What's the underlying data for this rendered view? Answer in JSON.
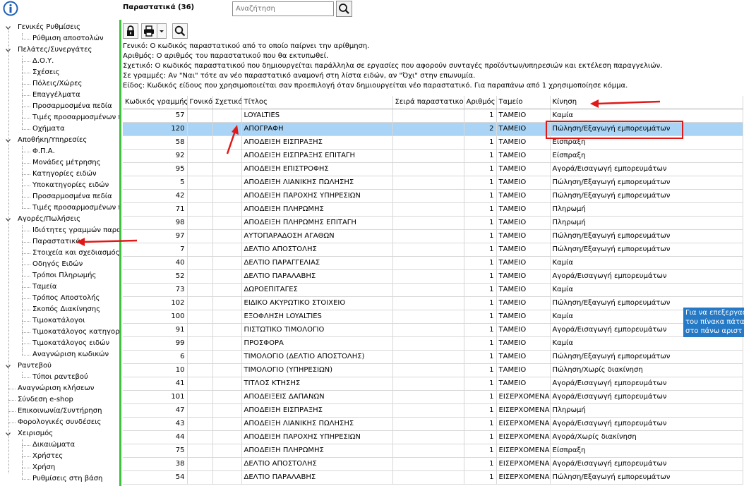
{
  "app": {
    "title": "Παραστατικά (36)"
  },
  "search": {
    "placeholder": "Αναζήτηση"
  },
  "toolbar": {
    "buttons": [
      "lock-icon",
      "printer-icon",
      "dropdown-arrow-icon",
      "search-icon"
    ]
  },
  "sidebar": {
    "groups": [
      {
        "label": "Γενικές Ρυθμίσεις",
        "items": [
          "Ρύθμιση αποστολών"
        ]
      },
      {
        "label": "Πελάτες/Συνεργάτες",
        "items": [
          "Δ.Ο.Υ.",
          "Σχέσεις",
          "Πόλεις/Χώρες",
          "Επαγγέλματα",
          "Προσαρμοσμένα πεδία",
          "Τιμές προσαρμοσμένων π",
          "Οχήματα"
        ]
      },
      {
        "label": "Αποθήκη/Υπηρεσίες",
        "items": [
          "Φ.Π.Α.",
          "Μονάδες μέτρησης",
          "Κατηγορίες ειδών",
          "Υποκατηγορίες ειδών",
          "Προσαρμοσμένα πεδία",
          "Τιμές προσαρμοσμένων π"
        ]
      },
      {
        "label": "Αγορές/Πωλήσεις",
        "items": [
          "Ιδιότητες γραμμών παρασ",
          "Παραστατικά",
          "Στοιχεία και σχεδιασμός π",
          "Οδηγός Ειδών",
          "Τρόποι Πληρωμής",
          "Ταμεία",
          "Τρόπος Αποστολής",
          "Σκοπός Διακίνησης",
          "Τιμοκατάλογοι",
          "Τιμοκατάλογος κατηγοριώ",
          "Τιμοκατάλογος ειδών",
          "Αναγνώριση κωδικών"
        ]
      },
      {
        "label": "Ραντεβού",
        "items": [
          "Τύποι ραντεβού"
        ]
      },
      {
        "label": "Αναγνώριση κλήσεων",
        "items": []
      },
      {
        "label": "Σύνδεση e-shop",
        "items": []
      },
      {
        "label": "Επικοινωνία/Συντήρηση",
        "items": []
      },
      {
        "label": "Φορολογικές συνδέσεις",
        "items": []
      },
      {
        "label": "Χειρισμός",
        "items": [
          "Δικαιώματα",
          "Χρήστες",
          "Χρήση",
          "Ρυθμίσεις στη βάση"
        ]
      }
    ]
  },
  "description": [
    "Γενικό: Ο κωδικός παραστατικού από το οποίο παίρνει την αρίθμηση.",
    "Αριθμός: Ο αριθμός του παραστατικού που θα εκτυπωθεί.",
    "Σχετικό: Ο κωδικός παραστατικού που δημιουργείται παράλληλα σε εργασίες που αφορούν συνταγές προϊόντων/υπηρεσιών και εκτέλεση παραγγελιών.",
    "Σε γραμμές: Αν \"Ναι\" τότε αν νέο παραστατικό αναμονή στη λίστα ειδών, αν \"Όχι\" στην επωνυμία.",
    "Είδος: Κωδικός είδους που χρησιμοποιείται σαν προεπιλογή όταν δημιουργείται νέο παραστατικό. Για παραπάνω από 1 χρησιμοποίησε κόμμα."
  ],
  "table": {
    "columns": [
      "Κωδικός γραμμής",
      "Γονικό",
      "Σχετικό",
      "Τίτλος",
      "Σειρά παραστατικού",
      "Αριθμός",
      "Ταμείο",
      "Κίνηση"
    ],
    "rows": [
      [
        "57",
        "",
        "",
        "LOYALTIES",
        "",
        "1",
        "ΤΑΜΕΙΟ",
        "Καμία"
      ],
      [
        "120",
        "",
        "",
        "ΑΠΟΓΡΑΦΗ",
        "",
        "2",
        "ΤΑΜΕΙΟ",
        "Πώληση/Εξαγωγή εμπορευμάτων"
      ],
      [
        "58",
        "",
        "",
        "ΑΠΟΔΕΙΞΗ ΕΙΣΠΡΑΞΗΣ",
        "",
        "1",
        "ΤΑΜΕΙΟ",
        "Είσπραξη"
      ],
      [
        "92",
        "",
        "",
        "ΑΠΟΔΕΙΞΗ ΕΙΣΠΡΑΞΗΣ ΕΠΙΤΑΓΗ",
        "",
        "1",
        "ΤΑΜΕΙΟ",
        "Είσπραξη"
      ],
      [
        "95",
        "",
        "",
        "ΑΠΟΔΕΙΞΗ ΕΠΙΣΤΡΟΦΗΣ",
        "",
        "1",
        "ΤΑΜΕΙΟ",
        "Αγορά/Εισαγωγή εμπορευμάτων"
      ],
      [
        "5",
        "",
        "",
        "ΑΠΟΔΕΙΞΗ ΛΙΑΝΙΚΗΣ ΠΩΛΗΣΗΣ",
        "",
        "1",
        "ΤΑΜΕΙΟ",
        "Πώληση/Εξαγωγή εμπορευμάτων"
      ],
      [
        "42",
        "",
        "",
        "ΑΠΟΔΕΙΞΗ ΠΑΡΟΧΗΣ ΥΠΗΡΕΣΙΩΝ",
        "",
        "1",
        "ΤΑΜΕΙΟ",
        "Πώληση/Εξαγωγή εμπορευμάτων"
      ],
      [
        "71",
        "",
        "",
        "ΑΠΟΔΕΙΞΗ ΠΛΗΡΩΜΗΣ",
        "",
        "1",
        "ΤΑΜΕΙΟ",
        "Πληρωμή"
      ],
      [
        "98",
        "",
        "",
        "ΑΠΟΔΕΙΞΗ ΠΛΗΡΩΜΗΣ ΕΠΙΤΑΓΗ",
        "",
        "1",
        "ΤΑΜΕΙΟ",
        "Πληρωμή"
      ],
      [
        "97",
        "",
        "",
        "ΑΥΤΟΠΑΡΑΔΟΣΗ ΑΓΑΘΩΝ",
        "",
        "1",
        "ΤΑΜΕΙΟ",
        "Πώληση/Εξαγωγή εμπορευμάτων"
      ],
      [
        "7",
        "",
        "",
        "ΔΕΛΤΙΟ ΑΠΟΣΤΟΛΗΣ",
        "",
        "1",
        "ΤΑΜΕΙΟ",
        "Πώληση/Εξαγωγή εμπορευμάτων"
      ],
      [
        "40",
        "",
        "",
        "ΔΕΛΤΙΟ ΠΑΡΑΓΓΕΛΙΑΣ",
        "",
        "1",
        "ΤΑΜΕΙΟ",
        "Καμία"
      ],
      [
        "52",
        "",
        "",
        "ΔΕΛΤΙΟ ΠΑΡΑΛΑΒΗΣ",
        "",
        "1",
        "ΤΑΜΕΙΟ",
        "Αγορά/Εισαγωγή εμπορευμάτων"
      ],
      [
        "73",
        "",
        "",
        "ΔΩΡΟΕΠΙΤΑΓΕΣ",
        "",
        "1",
        "ΤΑΜΕΙΟ",
        "Καμία"
      ],
      [
        "102",
        "",
        "",
        "ΕΙΔΙΚΟ ΑΚΥΡΩΤΙΚΟ ΣΤΟΙΧΕΙΟ",
        "",
        "1",
        "ΤΑΜΕΙΟ",
        "Πώληση/Εξαγωγή εμπορευμάτων"
      ],
      [
        "100",
        "",
        "",
        "ΕΞΟΦΛΗΣΗ LOYALTIES",
        "",
        "1",
        "ΤΑΜΕΙΟ",
        "Καμία"
      ],
      [
        "91",
        "",
        "",
        "ΠΙΣΤΩΤΙΚΟ ΤΙΜΟΛΟΓΙΟ",
        "",
        "1",
        "ΤΑΜΕΙΟ",
        "Αγορά/Εισαγωγή εμπορευμάτων"
      ],
      [
        "99",
        "",
        "",
        "ΠΡΟΣΦΟΡΑ",
        "",
        "1",
        "ΤΑΜΕΙΟ",
        "Καμία"
      ],
      [
        "6",
        "",
        "",
        "ΤΙΜΟΛΟΓΙΟ (ΔΕΛΤΙΟ ΑΠΟΣΤΟΛΗΣ)",
        "",
        "1",
        "ΤΑΜΕΙΟ",
        "Πώληση/Εξαγωγή εμπορευμάτων"
      ],
      [
        "10",
        "",
        "",
        "ΤΙΜΟΛΟΓΙΟ (ΥΠΗΡΕΣΙΩΝ)",
        "",
        "1",
        "ΤΑΜΕΙΟ",
        "Πώληση/Χωρίς διακίνηση"
      ],
      [
        "41",
        "",
        "",
        "ΤΙΤΛΟΣ ΚΤΗΣΗΣ",
        "",
        "1",
        "ΤΑΜΕΙΟ",
        "Αγορά/Εισαγωγή εμπορευμάτων"
      ],
      [
        "101",
        "",
        "",
        "ΑΠΟΔΕΙΞΕΙΣ ΔΑΠΑΝΩΝ",
        "",
        "1",
        "ΕΙΣΕΡΧΟΜΕΝΑ",
        "Αγορά/Εισαγωγή εμπορευμάτων"
      ],
      [
        "47",
        "",
        "",
        "ΑΠΟΔΕΙΞΗ ΕΙΣΠΡΑΞΗΣ",
        "",
        "1",
        "ΕΙΣΕΡΧΟΜΕΝΑ",
        "Πληρωμή"
      ],
      [
        "43",
        "",
        "",
        "ΑΠΟΔΕΙΞΗ ΛΙΑΝΙΚΗΣ ΠΩΛΗΣΗΣ",
        "",
        "1",
        "ΕΙΣΕΡΧΟΜΕΝΑ",
        "Αγορά/Εισαγωγή εμπορευμάτων"
      ],
      [
        "44",
        "",
        "",
        "ΑΠΟΔΕΙΞΗ ΠΑΡΟΧΗΣ ΥΠΗΡΕΣΙΩΝ",
        "",
        "1",
        "ΕΙΣΕΡΧΟΜΕΝΑ",
        "Αγορά/Χωρίς διακίνηση"
      ],
      [
        "75",
        "",
        "",
        "ΑΠΟΔΕΙΞΗ ΠΛΗΡΩΜΗΣ",
        "",
        "1",
        "ΕΙΣΕΡΧΟΜΕΝΑ",
        "Είσπραξη"
      ],
      [
        "38",
        "",
        "",
        "ΔΕΛΤΙΟ ΑΠΟΣΤΟΛΗΣ",
        "",
        "1",
        "ΕΙΣΕΡΧΟΜΕΝΑ",
        "Αγορά/Εισαγωγή εμπορευμάτων"
      ],
      [
        "54",
        "",
        "",
        "ΔΕΛΤΙΟ ΠΑΡΑΛΑΒΗΣ",
        "",
        "1",
        "ΕΙΣΕΡΧΟΜΕΝΑ",
        "Πώληση/Εξαγωγή εμπορευμάτων"
      ]
    ],
    "selected_row": 1
  },
  "tooltip": {
    "lines": [
      "Για να επεξεργασ",
      "του πίνακα πάτα",
      "στο πάνω αριστ"
    ]
  },
  "colors": {
    "accent": "#3fc03f",
    "selection": "#a9d4f5",
    "annotation": "#e01818",
    "tooltip": "#2579c5",
    "info": "#1f5fb5"
  }
}
